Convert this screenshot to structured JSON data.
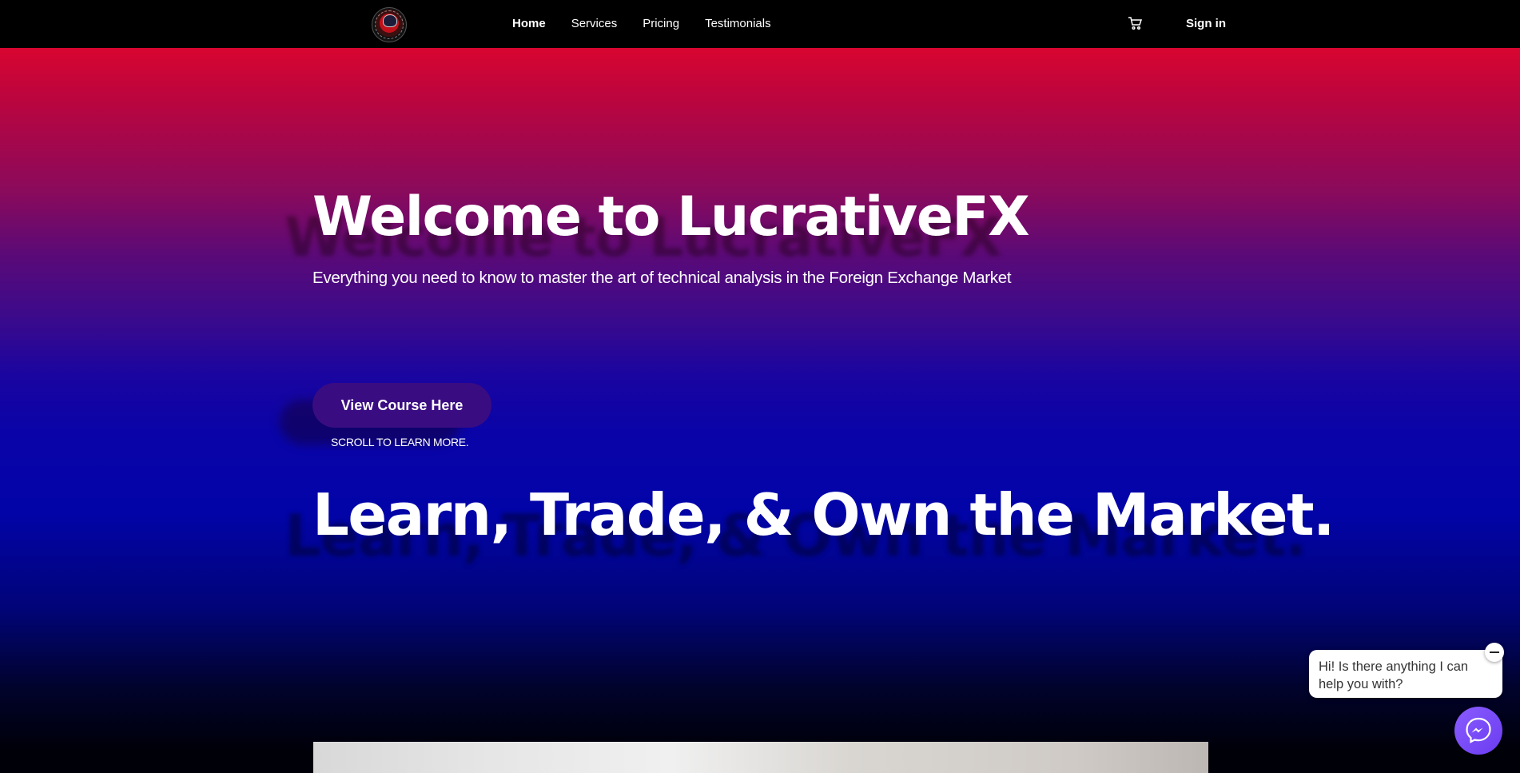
{
  "nav": {
    "links": [
      "Home",
      "Services",
      "Pricing",
      "Testimonials"
    ],
    "active": "Home",
    "sign_in": "Sign in",
    "cart_icon": "cart-icon",
    "logo_icon": "bull-logo-icon"
  },
  "hero": {
    "title": "Welcome to LucrativeFX",
    "subtitle": "Everything you need to know to master the art of technical analysis in the Foreign Exchange Market",
    "cta_label": "View Course Here",
    "scroll_note": "SCROLL TO LEARN MORE.",
    "tagline": "Learn, Trade, & Own the Market.",
    "gradient_colors": [
      "#e60524",
      "#5a0a78",
      "#0204a8",
      "#000008"
    ]
  },
  "chat": {
    "message": "Hi! Is there anything I can help you with?",
    "close_icon": "minus-icon",
    "launcher_icon": "messenger-icon",
    "accent": "#7b4dff"
  }
}
